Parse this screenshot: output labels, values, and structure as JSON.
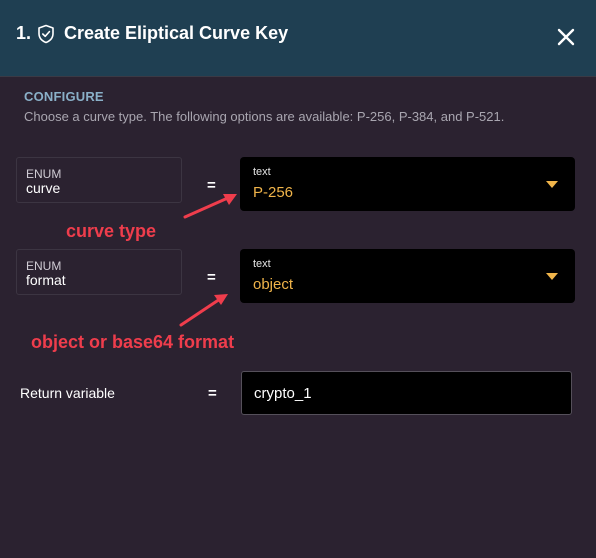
{
  "header": {
    "number": "1.",
    "title": "Create Eliptical Curve Key"
  },
  "configure": {
    "title": "CONFIGURE",
    "description": "Choose a curve type. The following options are available: P-256, P-384, and P-521."
  },
  "params": [
    {
      "type": "ENUM",
      "name": "curve",
      "equals": "=",
      "value_type": "text",
      "value": "P-256",
      "annotation": "curve type"
    },
    {
      "type": "ENUM",
      "name": "format",
      "equals": "=",
      "value_type": "text",
      "value": "object",
      "annotation": "object or base64 format"
    }
  ],
  "return": {
    "label": "Return variable",
    "equals": "=",
    "value": "crypto_1"
  },
  "colors": {
    "header_bg": "#1f3f52",
    "body_bg": "#2b2230",
    "accent": "#f0b44a",
    "annotation": "#ef3d4c",
    "section_title": "#8ab0c8"
  }
}
